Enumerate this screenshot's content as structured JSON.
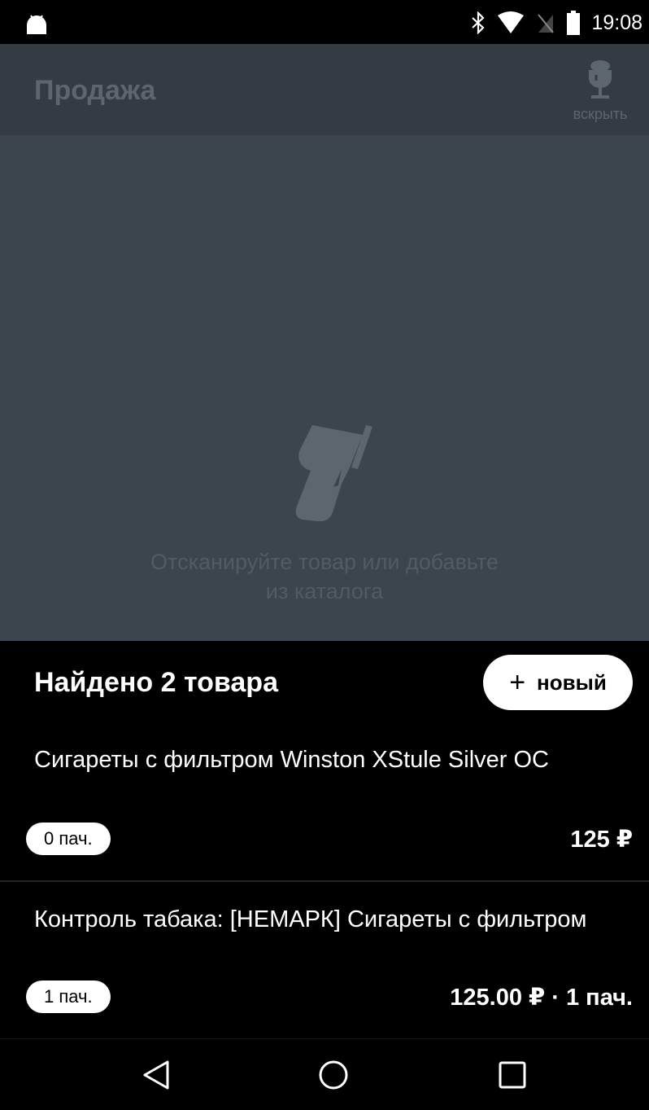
{
  "status_bar": {
    "time": "19:08",
    "icons": [
      "android-icon",
      "bluetooth-icon",
      "wifi-icon",
      "no-sim-icon",
      "battery-icon"
    ]
  },
  "app_bar": {
    "title": "Продажа",
    "open_action_label": "вскрыть",
    "open_action_icon": "goblet-icon"
  },
  "empty_state": {
    "icon": "barcode-scanner-icon",
    "line1": "Отсканируйте товар или добавьте",
    "line2": "из каталога"
  },
  "results": {
    "title": "Найдено 2 товара",
    "new_button_label": "новый",
    "items": [
      {
        "name": "Сигареты с фильтром Winston XStule Silver  ОС",
        "quantity": "0 пач.",
        "price": "125 ₽"
      },
      {
        "name": "Контроль табака: [НЕМАРК] Сигареты с фильтром",
        "quantity": "1 пач.",
        "price": "125.00 ₽ · 1 пач."
      }
    ]
  },
  "nav_bar": {
    "buttons": [
      "back-icon",
      "home-icon",
      "recents-icon"
    ]
  },
  "colors": {
    "scrim": "#3c444c",
    "app_bar": "#343b42",
    "sheet": "#000000",
    "pill": "#ffffff"
  }
}
